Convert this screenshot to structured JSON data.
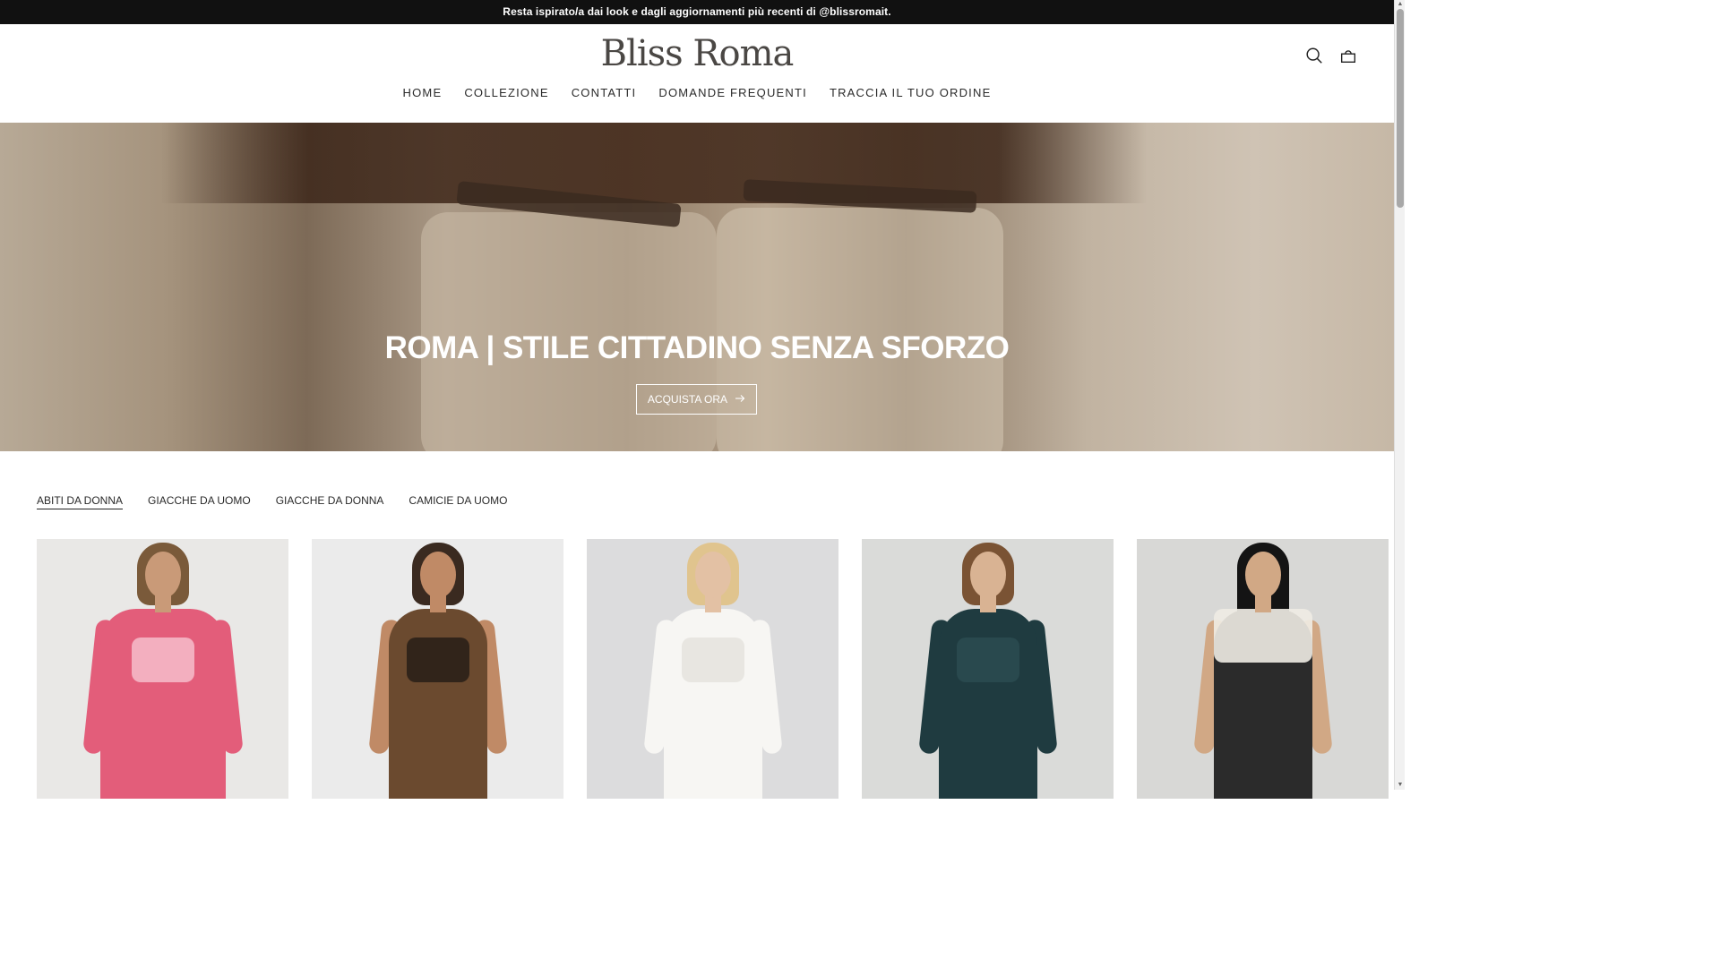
{
  "announcement": "Resta ispirato/a dai look e dagli aggiornamenti più recenti di @blissromait.",
  "brand": {
    "logo": "Bliss Roma"
  },
  "icons": {
    "search": "search-icon",
    "cart": "bag-icon",
    "arrow": "arrow-right-icon"
  },
  "nav": [
    "HOME",
    "COLLEZIONE",
    "CONTATTI",
    "DOMANDE FREQUENTI",
    "TRACCIA IL TUO ORDINE"
  ],
  "hero": {
    "title": "ROMA | STILE CITTADINO SENZA SFORZO",
    "button": "ACQUISTA ORA"
  },
  "tabs": [
    {
      "label": "ABITI DA DONNA",
      "active": true
    },
    {
      "label": "GIACCHE DA UOMO",
      "active": false
    },
    {
      "label": "GIACCHE DA DONNA",
      "active": false
    },
    {
      "label": "CAMICIE DA UOMO",
      "active": false
    }
  ],
  "products": [
    {
      "image": "pink-patterned-shirt-dress",
      "bg": "#e9e8e6",
      "dress": "#e35d7a",
      "accent": "#f4b8c6"
    },
    {
      "image": "leopard-print-slip-dress",
      "bg": "#ebebeb",
      "dress": "#6b4a2f",
      "accent": "#2b2018"
    },
    {
      "image": "white-long-sleeve-mini-dress",
      "bg": "#dcdcdd",
      "dress": "#f7f6f3",
      "accent": "#e6e4df"
    },
    {
      "image": "dark-green-knit-maxi-dress",
      "bg": "#dadbd9",
      "dress": "#1f3b40",
      "accent": "#2a4b50"
    },
    {
      "image": "black-denim-overalls",
      "bg": "#d8d8d6",
      "dress": "#2b2b2b",
      "accent": "#f0ece4"
    }
  ],
  "colors": {
    "announcement_bg": "#111111",
    "logo": "#4a4744",
    "text": "#2a2a2a"
  }
}
